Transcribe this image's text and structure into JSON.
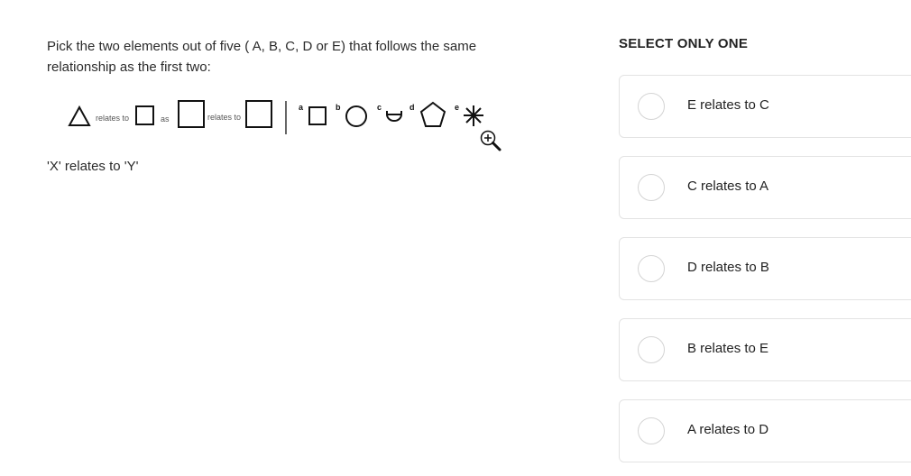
{
  "question": {
    "text": "Pick the two elements out of five ( A, B, C, D or E) that follows the same relationship as the first two:",
    "subtext": "'X' relates to 'Y'"
  },
  "figure": {
    "relates_to_1": "relates to",
    "as": "as",
    "relates_to_2": "relates to",
    "letters": [
      "a",
      "b",
      "c",
      "d",
      "e"
    ]
  },
  "options_title": "SELECT ONLY ONE",
  "options": [
    {
      "label": "E relates to C"
    },
    {
      "label": "C relates to A"
    },
    {
      "label": "D relates to B"
    },
    {
      "label": "B relates to E"
    },
    {
      "label": "A relates to D"
    }
  ],
  "icons": {
    "zoom": "zoom-in-icon"
  }
}
